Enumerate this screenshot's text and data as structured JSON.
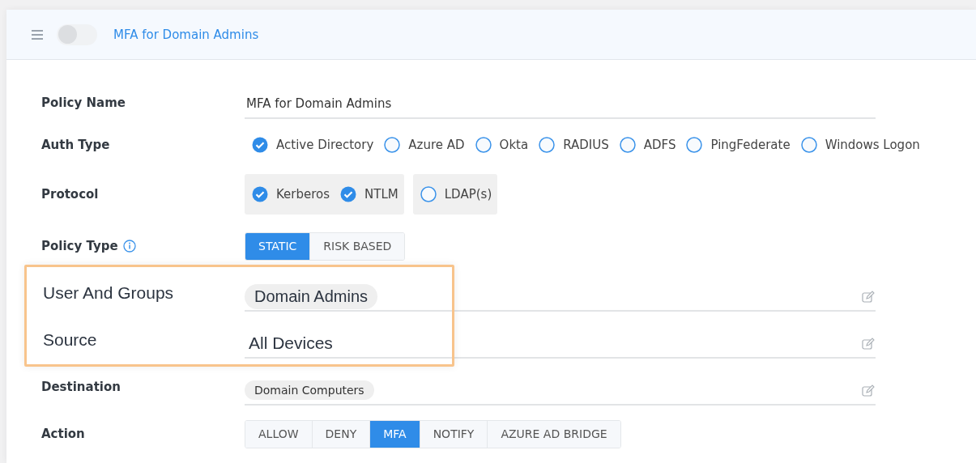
{
  "header": {
    "title": "MFA for Domain Admins",
    "toggle": {
      "on": false
    }
  },
  "rows": [
    {
      "kind": "text-field",
      "label": "Policy Name",
      "value": "MFA for Domain Admins",
      "emphasized": false
    },
    {
      "kind": "radio-group",
      "label": "Auth Type",
      "emphasized": false,
      "options": [
        {
          "label": "Active Directory",
          "selected": true
        },
        {
          "label": "Azure AD",
          "selected": false
        },
        {
          "label": "Okta",
          "selected": false
        },
        {
          "label": "RADIUS",
          "selected": false
        },
        {
          "label": "ADFS",
          "selected": false
        },
        {
          "label": "PingFederate",
          "selected": false
        },
        {
          "label": "Windows Logon",
          "selected": false
        }
      ]
    },
    {
      "kind": "check-groups",
      "label": "Protocol",
      "emphasized": false,
      "groups": [
        [
          {
            "label": "Kerberos",
            "checked": true
          },
          {
            "label": "NTLM",
            "checked": true
          }
        ],
        [
          {
            "label": "LDAP(s)",
            "checked": false
          }
        ]
      ]
    },
    {
      "kind": "segmented",
      "label": "Policy Type",
      "info": true,
      "emphasized": false,
      "options": [
        {
          "label": "STATIC",
          "selected": true
        },
        {
          "label": "RISK BASED",
          "selected": false
        }
      ]
    },
    {
      "kind": "chip-field",
      "label": "User And Groups",
      "chips": [
        "Domain Admins"
      ],
      "emphasized": true
    },
    {
      "kind": "plain-field",
      "label": "Source",
      "value": "All Devices",
      "emphasized": true
    },
    {
      "kind": "chip-field",
      "label": "Destination",
      "chips": [
        "Domain Computers"
      ],
      "emphasized": false
    },
    {
      "kind": "segmented",
      "label": "Action",
      "emphasized": false,
      "options": [
        {
          "label": "ALLOW",
          "selected": false
        },
        {
          "label": "DENY",
          "selected": false
        },
        {
          "label": "MFA",
          "selected": true
        },
        {
          "label": "NOTIFY",
          "selected": false
        },
        {
          "label": "AZURE AD BRIDGE",
          "selected": false
        }
      ]
    }
  ]
}
